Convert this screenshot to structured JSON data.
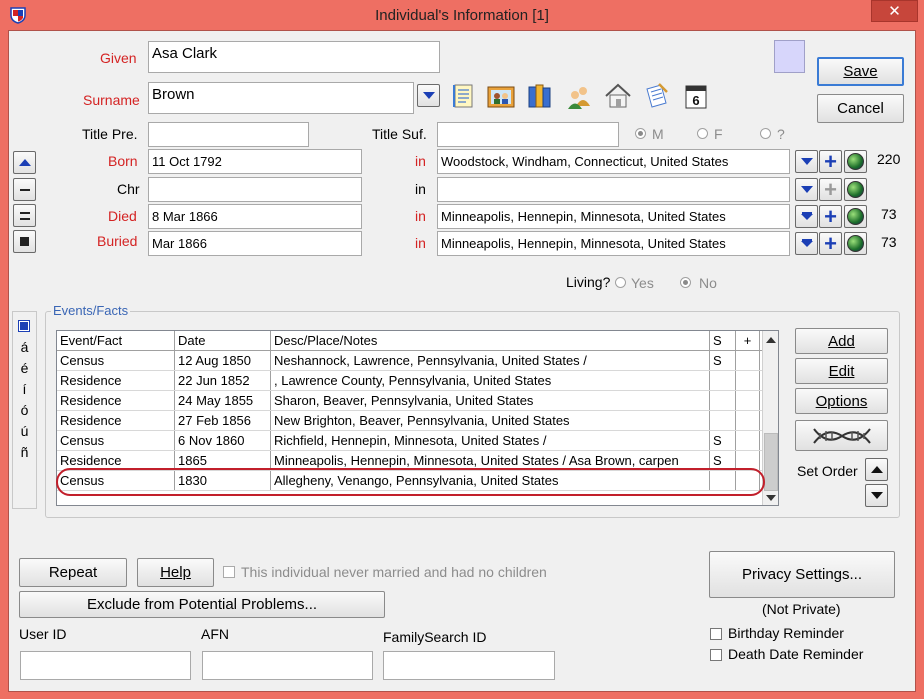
{
  "window": {
    "title": "Individual's Information  [1]",
    "close_glyph": "✕"
  },
  "names": {
    "given_label": "Given",
    "given_value": "Asa Clark",
    "surname_label": "Surname",
    "surname_value": "Brown",
    "title_pre_label": "Title Pre.",
    "title_pre_value": "",
    "title_suf_label": "Title Suf.",
    "title_suf_value": ""
  },
  "sex": {
    "male_label": "M",
    "female_label": "F",
    "unknown_label": "?",
    "selected": "M"
  },
  "buttons": {
    "save": "Save",
    "cancel": "Cancel",
    "add": "Add",
    "edit": "Edit",
    "options": "Options",
    "set_order": "Set Order",
    "repeat": "Repeat",
    "help": "Help",
    "exclude": "Exclude from Potential Problems...",
    "privacy": "Privacy Settings..."
  },
  "vitals": {
    "in_label": "in",
    "born": {
      "label": "Born",
      "date": "11 Oct 1792",
      "place": "Woodstock, Windham, Connecticut, United States",
      "count": "220"
    },
    "chr": {
      "label": "Chr",
      "date": "",
      "place": "",
      "count": ""
    },
    "died": {
      "label": "Died",
      "date": "8 Mar 1866",
      "place": "Minneapolis, Hennepin, Minnesota, United States",
      "count": "73"
    },
    "buried": {
      "label": "Buried",
      "date": "Mar 1866",
      "place": "Minneapolis, Hennepin, Minnesota, United States",
      "count": "73"
    }
  },
  "living": {
    "label": "Living?",
    "yes": "Yes",
    "no": "No",
    "selected": "No"
  },
  "events": {
    "group_title": "Events/Facts",
    "columns": [
      "Event/Fact",
      "Date",
      "Desc/Place/Notes",
      "S",
      "+"
    ],
    "rows": [
      {
        "event": "Census",
        "date": "12 Aug 1850",
        "place": "Neshannock, Lawrence, Pennsylvania, United States /",
        "s": "S",
        "plus": ""
      },
      {
        "event": "Residence",
        "date": "22 Jun 1852",
        "place": ", Lawrence County, Pennsylvania, United States",
        "s": "",
        "plus": ""
      },
      {
        "event": "Residence",
        "date": "24 May 1855",
        "place": "Sharon, Beaver, Pennsylvania, United States",
        "s": "",
        "plus": ""
      },
      {
        "event": "Residence",
        "date": "27 Feb 1856",
        "place": "New Brighton, Beaver, Pennsylvania, United States",
        "s": "",
        "plus": ""
      },
      {
        "event": "Census",
        "date": "6 Nov 1860",
        "place": "Richfield, Hennepin, Minnesota, United States /",
        "s": "S",
        "plus": ""
      },
      {
        "event": "Residence",
        "date": "1865",
        "place": "Minneapolis, Hennepin, Minnesota, United States / Asa Brown, carpen",
        "s": "S",
        "plus": ""
      },
      {
        "event": "Census",
        "date": "1830",
        "place": "Allegheny, Venango, Pennsylvania, United States",
        "s": "",
        "plus": ""
      }
    ]
  },
  "sidebar_chars": [
    "á",
    "é",
    "í",
    "ó",
    "ú",
    "ñ"
  ],
  "never_married_label": "This individual never married and had no children",
  "privacy_status": "(Not Private)",
  "ids": {
    "user_id_label": "User ID",
    "user_id_value": "",
    "afn_label": "AFN",
    "afn_value": "",
    "familysearch_label": "FamilySearch ID",
    "familysearch_value": ""
  },
  "reminders": {
    "birthday": "Birthday Reminder",
    "death_date": "Death Date Reminder"
  },
  "colors": {
    "title_bar": "#ee6f63",
    "close_button": "#c7463b",
    "accent_blue": "#1b3fb5",
    "label_red": "#d42323",
    "highlight_ring": "#c21f2b",
    "color_swatch": "#d7d6fb"
  }
}
